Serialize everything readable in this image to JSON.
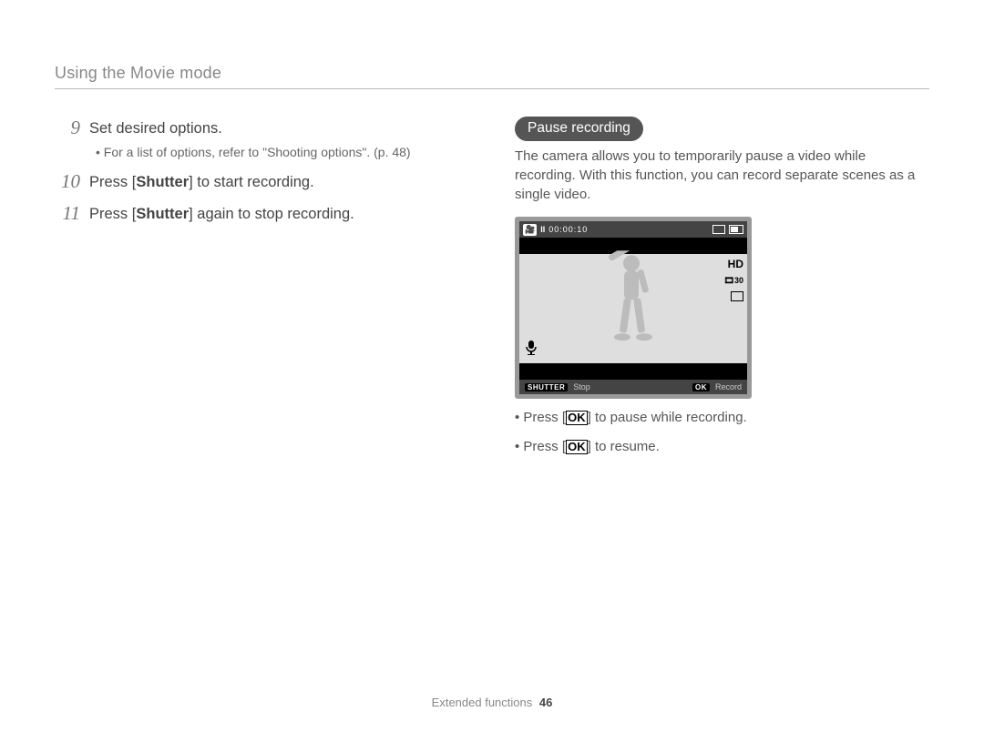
{
  "header": {
    "title": "Using the Movie mode"
  },
  "left": {
    "steps": [
      {
        "num": "9",
        "text_parts": [
          "Set desired options."
        ],
        "sub": "For a list of options, refer to \"Shooting options\". (p. 48)"
      },
      {
        "num": "10",
        "text_parts": [
          "Press [",
          "Shutter",
          "] to start recording."
        ]
      },
      {
        "num": "11",
        "text_parts": [
          "Press [",
          "Shutter",
          "] again to stop recording."
        ]
      }
    ]
  },
  "right": {
    "heading": "Pause recording",
    "description": "The camera allows you to temporarily pause a video while recording. With this function, you can record separate scenes as a single video.",
    "lcd": {
      "time": "00:00:10",
      "hd": "HD",
      "fps": "30",
      "bottom_shutter_label": "SHUTTER",
      "bottom_stop": "Stop",
      "bottom_ok_label": "OK",
      "bottom_record": "Record"
    },
    "tips": [
      {
        "pre": "Press [",
        "key": "OK",
        "post": "] to pause while recording."
      },
      {
        "pre": "Press [",
        "key": "OK",
        "post": "] to resume."
      }
    ]
  },
  "footer": {
    "section": "Extended functions",
    "page": "46"
  }
}
